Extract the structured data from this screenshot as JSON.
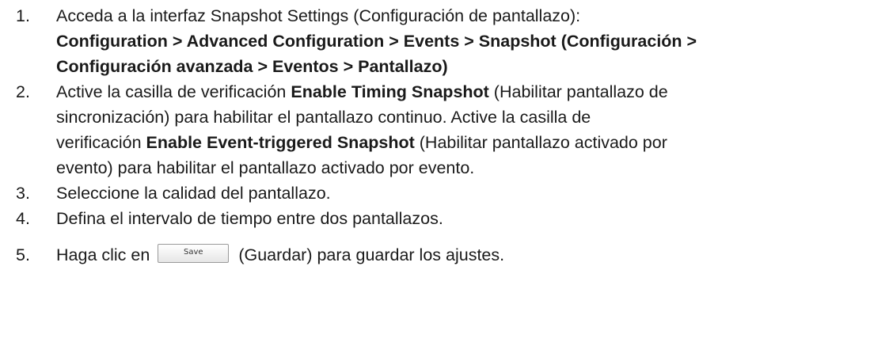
{
  "steps": [
    {
      "number": "1.",
      "intro": "Acceda a la interfaz Snapshot Settings (Configuración de pantallazo):",
      "path_line1": "Configuration > Advanced Configuration > Events > Snapshot (Configuración >",
      "path_line2": "Configuración avanzada > Eventos > Pantallazo)"
    },
    {
      "number": "2.",
      "line1_pre": "Active la casilla de verificación ",
      "line1_bold": "Enable Timing Snapshot",
      "line1_post": " (Habilitar pantallazo de",
      "line2": "sincronización) para habilitar el pantallazo continuo. Active la casilla de",
      "line3_pre": "verificación ",
      "line3_bold": "Enable Event-triggered Snapshot",
      "line3_post": " (Habilitar pantallazo activado por",
      "line4": "evento) para habilitar el pantallazo activado por evento."
    },
    {
      "number": "3.",
      "text": "Seleccione la calidad del pantallazo."
    },
    {
      "number": "4.",
      "text": "Defina el intervalo de tiempo entre dos pantallazos."
    },
    {
      "number": "5.",
      "pre": "Haga clic en",
      "button_label": "Save",
      "post": "(Guardar) para guardar los ajustes."
    }
  ]
}
